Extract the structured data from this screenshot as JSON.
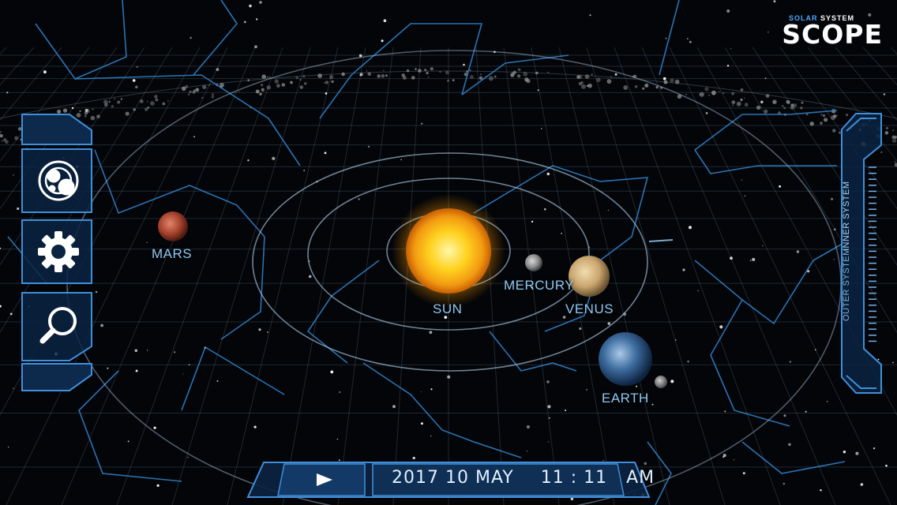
{
  "app": {
    "logo_small_1": "SOLAR",
    "logo_small_2": "SYSTEM",
    "logo_big": "SCOPE"
  },
  "planets": {
    "sun": "SUN",
    "mercury": "MERCURY",
    "venus": "VENUS",
    "earth": "EARTH",
    "mars": "MARS"
  },
  "side_menu": {
    "items": [
      {
        "name": "planets-overview",
        "icon": "solar-system-icon"
      },
      {
        "name": "settings",
        "icon": "gear-icon"
      },
      {
        "name": "search",
        "icon": "magnifier-icon"
      }
    ]
  },
  "system_tabs": {
    "inner": "INNER SYSTEM",
    "outer": "OUTER SYSTEM"
  },
  "timebar": {
    "play_icon": "play-icon",
    "date": "2017 10 MAY",
    "time": "11 : 11",
    "ampm": "AM"
  },
  "colors": {
    "accent": "#4a9ee8",
    "panel_fill": "#0d2a4d",
    "label": "#8fc8f2",
    "sun": "#ffd21f"
  }
}
